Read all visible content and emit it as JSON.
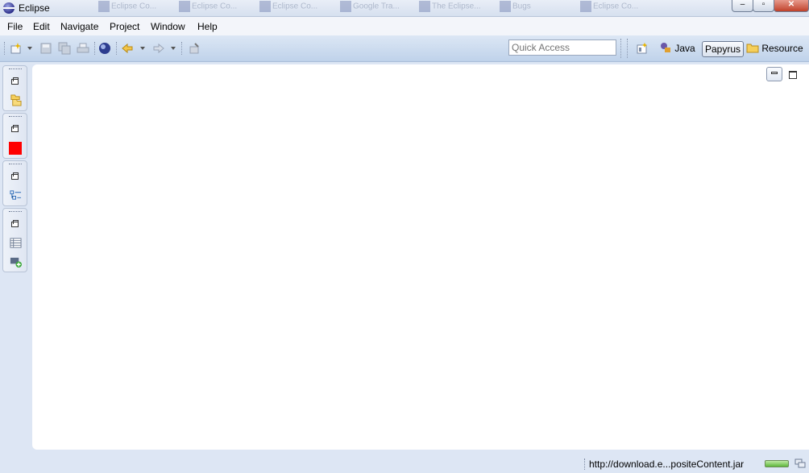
{
  "window": {
    "title": "Eclipse",
    "background_tabs": [
      "Eclipse Co...",
      "Eclipse Co...",
      "Eclipse Co...",
      "Google Tra...",
      "The Eclipse...",
      "Bugs",
      "Eclipse Co..."
    ]
  },
  "menu": {
    "items": [
      "File",
      "Edit",
      "Navigate",
      "Project",
      "Window",
      "Help"
    ]
  },
  "toolbar": {
    "quick_access_placeholder": "Quick Access",
    "perspectives": [
      {
        "label": "Java",
        "icon": "java-perspective-icon",
        "active": false
      },
      {
        "label": "Papyrus",
        "icon": "",
        "active": true
      },
      {
        "label": "Resource",
        "icon": "resource-folder-icon",
        "active": false
      }
    ]
  },
  "status": {
    "text": "http://download.e...positeContent.jar"
  },
  "colors": {
    "accent_red": "#ff0000",
    "toolbar": "#c9d9ee",
    "progress": "#5fb83d"
  }
}
